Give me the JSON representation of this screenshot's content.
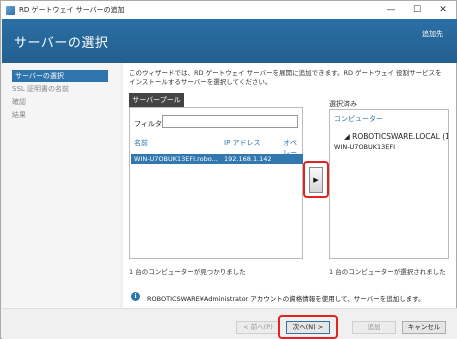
{
  "window": {
    "title": "RD ゲートウェイ サーバーの追加",
    "minimize": "—",
    "maximize": "☐",
    "close": "✕"
  },
  "header": {
    "page_title": "サーバーの選択",
    "destination": "追加先"
  },
  "nav": {
    "items": [
      {
        "label": "サーバーの選択"
      },
      {
        "label": "SSL 証明書の名前"
      },
      {
        "label": "確認"
      },
      {
        "label": "結果"
      }
    ]
  },
  "content": {
    "description": "このウィザードでは、RD ゲートウェイ サーバーを展開に追加できます。RD ゲートウェイ 役割サービスをインストールするサーバーを選択してください。",
    "pool_tab": "サーバープール",
    "filter_label": "フィルター:",
    "filter_value": "",
    "columns": {
      "name": "名前",
      "ip": "IP アドレス",
      "os": "オペレー"
    },
    "rows": [
      {
        "name": "WIN-U7OBUK13EFI.robo...",
        "ip": "192.168.1.142"
      }
    ],
    "pool_status": "1 台のコンピューターが見つかりました",
    "move_button": "▶",
    "selected_label": "選択済み",
    "selected_column": "コンピューター",
    "selected_group": "◢ ROBOTICSWARE.LOCAL (1",
    "selected_item": "WIN-U7OBUK13EFI",
    "selected_status": "1 台のコンピューターが選択されました",
    "info_icon": "i",
    "info_text": "ROBOTICSWARE¥Administrator アカウントの資格情報を使用して、サーバーを追加します。"
  },
  "footer": {
    "back": "< 前へ(P)",
    "next": "次へ(N) >",
    "add": "追加",
    "cancel": "キャンセル"
  }
}
